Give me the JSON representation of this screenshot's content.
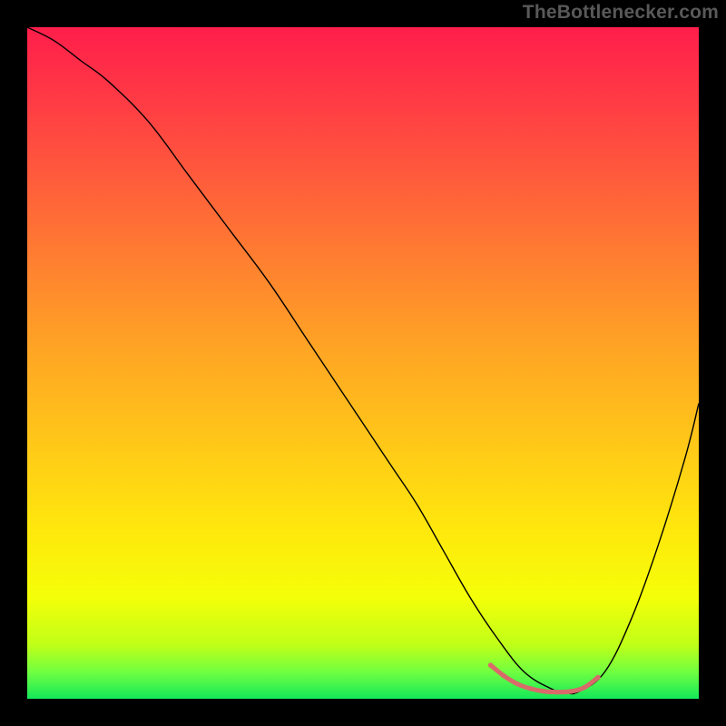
{
  "watermark": "TheBottlenecker.com",
  "chart_data": {
    "type": "line",
    "title": "",
    "xlabel": "",
    "ylabel": "",
    "xlim": [
      0,
      100
    ],
    "ylim": [
      0,
      100
    ],
    "grid": false,
    "legend": false,
    "background_gradient": {
      "stops": [
        {
          "offset": 0.0,
          "color": "#ff1e4b"
        },
        {
          "offset": 0.1,
          "color": "#ff3845"
        },
        {
          "offset": 0.22,
          "color": "#ff5a3c"
        },
        {
          "offset": 0.35,
          "color": "#ff8030"
        },
        {
          "offset": 0.48,
          "color": "#ffa524"
        },
        {
          "offset": 0.62,
          "color": "#ffc818"
        },
        {
          "offset": 0.75,
          "color": "#ffe80c"
        },
        {
          "offset": 0.85,
          "color": "#f4ff08"
        },
        {
          "offset": 0.92,
          "color": "#c0ff18"
        },
        {
          "offset": 0.96,
          "color": "#70ff40"
        },
        {
          "offset": 1.0,
          "color": "#14e85a"
        }
      ]
    },
    "series": [
      {
        "name": "bottleneck-curve",
        "stroke": "#000000",
        "stroke_width": 1.4,
        "x": [
          0,
          4,
          8,
          12,
          18,
          24,
          30,
          36,
          42,
          48,
          54,
          58,
          62,
          66,
          70,
          74,
          78,
          80,
          82,
          86,
          90,
          94,
          98,
          100
        ],
        "y": [
          100,
          98,
          95,
          92,
          86,
          78,
          70,
          62,
          53,
          44,
          35,
          29,
          22,
          15,
          9,
          4,
          1.5,
          1,
          1,
          4,
          12,
          23,
          36,
          44
        ]
      },
      {
        "name": "valley-highlight",
        "type": "scatter-line",
        "stroke": "#d96a6a",
        "stroke_width": 5.0,
        "rounded": true,
        "x": [
          69,
          71,
          73,
          75,
          77,
          79,
          81,
          83,
          85
        ],
        "y": [
          5.0,
          3.4,
          2.2,
          1.5,
          1.1,
          1.0,
          1.1,
          1.7,
          3.2
        ]
      }
    ],
    "comment": "All y-values are visual estimates (no axes/ticks in the source image). y=0 is the bottom of the gradient square, y=100 is the top."
  }
}
